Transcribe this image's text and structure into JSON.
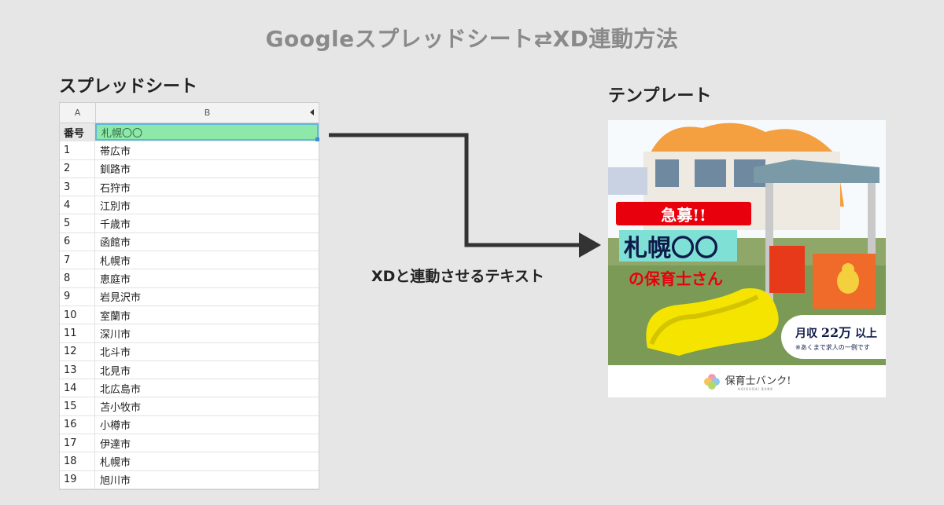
{
  "page_title": "Googleスプレッドシート⇄XD連動方法",
  "left_section_label": "スプレッドシート",
  "right_section_label": "テンプレート",
  "connector_label": "XDと連動させるテキスト",
  "spreadsheet": {
    "col_a": "A",
    "col_b": "B",
    "header_row": {
      "a": "番号",
      "b": "札幌〇〇"
    },
    "rows": [
      {
        "a": "1",
        "b": "帯広市"
      },
      {
        "a": "2",
        "b": "釧路市"
      },
      {
        "a": "3",
        "b": "石狩市"
      },
      {
        "a": "4",
        "b": "江別市"
      },
      {
        "a": "5",
        "b": "千歳市"
      },
      {
        "a": "6",
        "b": "函館市"
      },
      {
        "a": "7",
        "b": "札幌市"
      },
      {
        "a": "8",
        "b": "恵庭市"
      },
      {
        "a": "9",
        "b": "岩見沢市"
      },
      {
        "a": "10",
        "b": "室蘭市"
      },
      {
        "a": "11",
        "b": "深川市"
      },
      {
        "a": "12",
        "b": "北斗市"
      },
      {
        "a": "13",
        "b": "北見市"
      },
      {
        "a": "14",
        "b": "北広島市"
      },
      {
        "a": "15",
        "b": "苫小牧市"
      },
      {
        "a": "16",
        "b": "小樽市"
      },
      {
        "a": "17",
        "b": "伊達市"
      },
      {
        "a": "18",
        "b": "札幌市"
      },
      {
        "a": "19",
        "b": "旭川市"
      }
    ]
  },
  "template": {
    "urgent": "急募!!",
    "city": "札幌〇〇",
    "subtitle": "の保育士さん",
    "salary_prefix": "月収",
    "salary_amount": "22万",
    "salary_suffix": "以上",
    "salary_note": "※あくまで求人の一例です",
    "brand": "保育士バンク!",
    "brand_sub": "HOIKUSHI BANK"
  },
  "colors": {
    "selection_fill": "#8ee8a9",
    "selection_border": "#5fb6dd",
    "banner_red": "#e8000d",
    "banner_teal": "#7fe0d6"
  }
}
